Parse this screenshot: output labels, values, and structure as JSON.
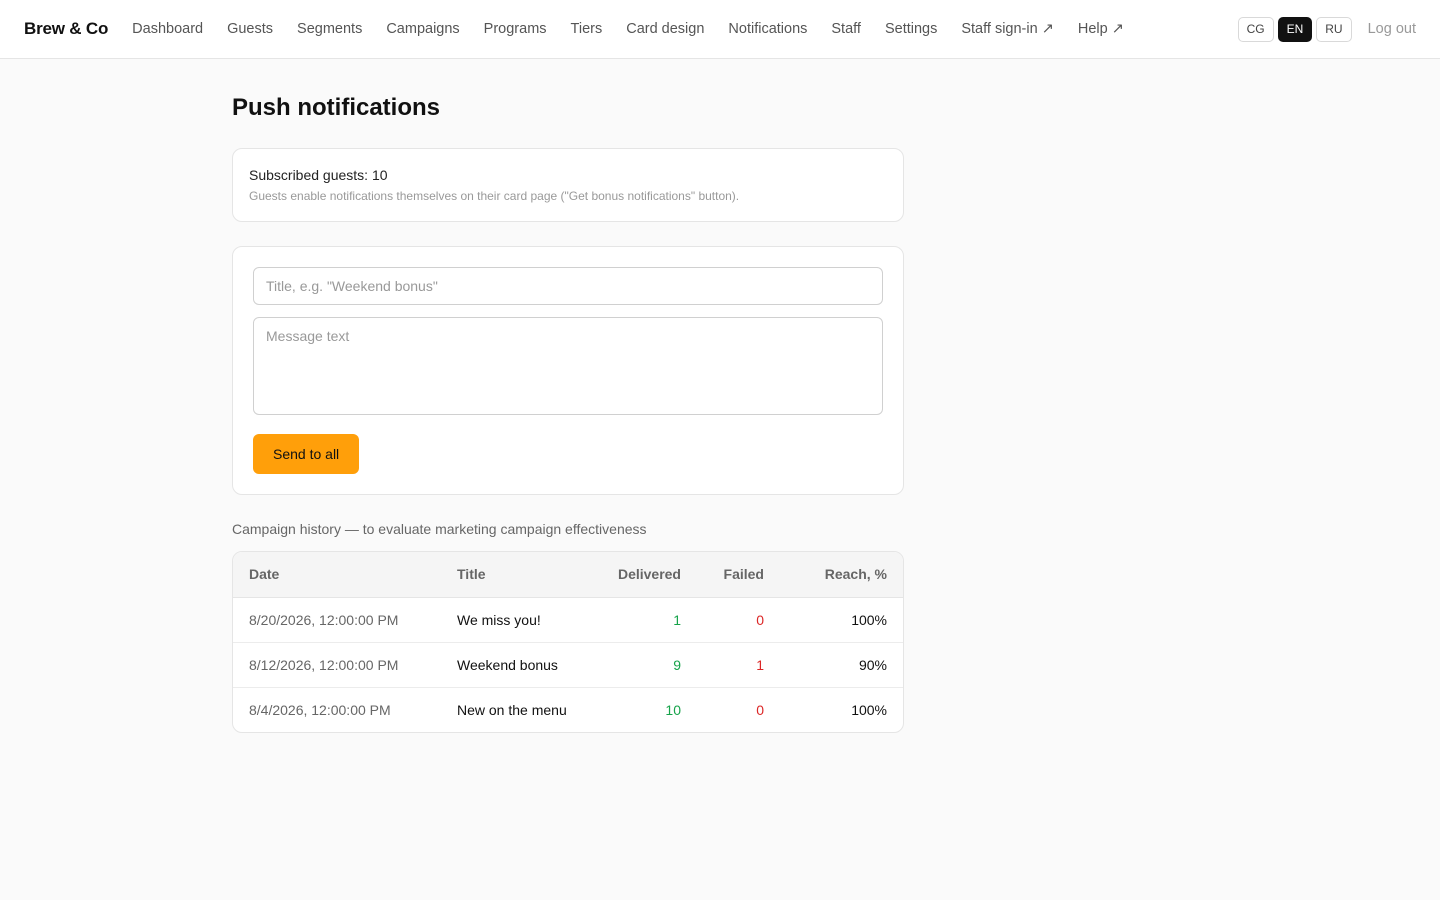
{
  "brand": "Brew & Co",
  "nav": [
    {
      "label": "Dashboard"
    },
    {
      "label": "Guests"
    },
    {
      "label": "Segments"
    },
    {
      "label": "Campaigns"
    },
    {
      "label": "Programs"
    },
    {
      "label": "Tiers"
    },
    {
      "label": "Card design"
    },
    {
      "label": "Notifications"
    },
    {
      "label": "Staff"
    },
    {
      "label": "Settings"
    },
    {
      "label": "Staff sign-in ↗"
    },
    {
      "label": "Help ↗"
    }
  ],
  "languages": [
    {
      "label": "CG",
      "active": false
    },
    {
      "label": "EN",
      "active": true
    },
    {
      "label": "RU",
      "active": false
    }
  ],
  "logout_label": "Log out",
  "page_title": "Push notifications",
  "subscription": {
    "line": "Subscribed guests: 10",
    "hint": "Guests enable notifications themselves on their card page (\"Get bonus notifications\" button)."
  },
  "form": {
    "title_placeholder": "Title, e.g. \"Weekend bonus\"",
    "title_value": "",
    "message_placeholder": "Message text",
    "message_value": "",
    "send_label": "Send to all"
  },
  "history": {
    "caption": "Campaign history — to evaluate marketing campaign effectiveness",
    "columns": {
      "date": "Date",
      "title": "Title",
      "delivered": "Delivered",
      "failed": "Failed",
      "reach": "Reach, %"
    },
    "rows": [
      {
        "date": "8/20/2026, 12:00:00 PM",
        "title": "We miss you!",
        "delivered": "1",
        "failed": "0",
        "reach": "100%"
      },
      {
        "date": "8/12/2026, 12:00:00 PM",
        "title": "Weekend bonus",
        "delivered": "9",
        "failed": "1",
        "reach": "90%"
      },
      {
        "date": "8/4/2026, 12:00:00 PM",
        "title": "New on the menu",
        "delivered": "10",
        "failed": "0",
        "reach": "100%"
      }
    ]
  },
  "colors": {
    "accent": "#ff9f0a",
    "delivered": "#16a34a",
    "failed": "#dc2626",
    "active_lang": "#111111"
  }
}
